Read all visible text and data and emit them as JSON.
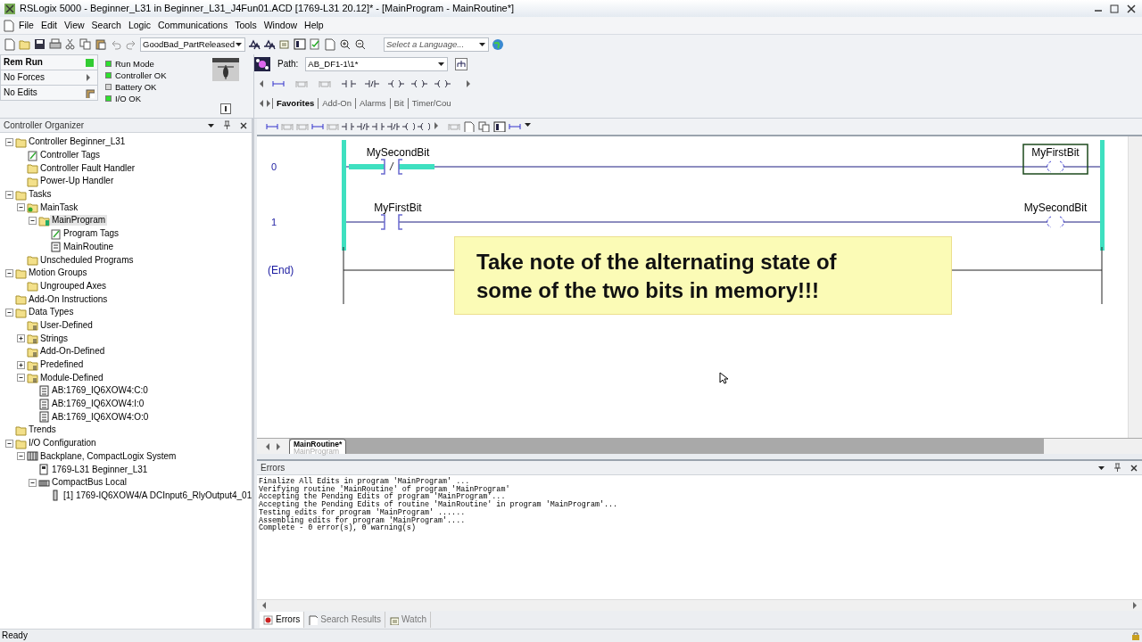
{
  "window": {
    "title": "RSLogix 5000 - Beginner_L31 in Beginner_L31_J4Fun01.ACD [1769-L31 20.12]* - [MainProgram - MainRoutine*]"
  },
  "menu": [
    "File",
    "Edit",
    "View",
    "Search",
    "Logic",
    "Communications",
    "Tools",
    "Window",
    "Help"
  ],
  "toolbar": {
    "routine_combo": "GoodBad_PartReleased",
    "language_combo": {
      "placeholder": "Select a Language..."
    }
  },
  "controller_status": {
    "rows": [
      {
        "label": "Rem Run"
      },
      {
        "label": "No Forces"
      },
      {
        "label": "No Edits"
      }
    ],
    "indicators": [
      {
        "label": "Run Mode",
        "on": true
      },
      {
        "label": "Controller OK",
        "on": true
      },
      {
        "label": "Battery OK",
        "on": false
      },
      {
        "label": "I/O OK",
        "on": true
      }
    ]
  },
  "path": {
    "label": "Path:",
    "value": "AB_DF1-1\\1*"
  },
  "instruction_tabs": [
    {
      "label": "Favorites",
      "selected": true
    },
    {
      "label": "Add-On",
      "selected": false
    },
    {
      "label": "Alarms",
      "selected": false
    },
    {
      "label": "Bit",
      "selected": false
    },
    {
      "label": "Timer/Cou",
      "selected": false
    }
  ],
  "organizer": {
    "title": "Controller Organizer",
    "tree": [
      {
        "label": "Controller Beginner_L31",
        "kind": "folder",
        "expanded": true,
        "selected": false,
        "children": [
          {
            "label": "Controller Tags",
            "kind": "tags",
            "selected": false
          },
          {
            "label": "Controller Fault Handler",
            "kind": "folder",
            "selected": false
          },
          {
            "label": "Power-Up Handler",
            "kind": "folder",
            "selected": false
          }
        ]
      },
      {
        "label": "Tasks",
        "kind": "folder",
        "expanded": true,
        "selected": false,
        "children": [
          {
            "label": "MainTask",
            "kind": "task",
            "expanded": true,
            "selected": false,
            "children": [
              {
                "label": "MainProgram",
                "kind": "program",
                "expanded": true,
                "selected": true,
                "children": [
                  {
                    "label": "Program Tags",
                    "kind": "tags",
                    "selected": false
                  },
                  {
                    "label": "MainRoutine",
                    "kind": "routine",
                    "selected": false
                  }
                ]
              }
            ]
          },
          {
            "label": "Unscheduled Programs",
            "kind": "folder",
            "selected": false
          }
        ]
      },
      {
        "label": "Motion Groups",
        "kind": "folder",
        "expanded": true,
        "selected": false,
        "children": [
          {
            "label": "Ungrouped Axes",
            "kind": "folder",
            "selected": false
          }
        ]
      },
      {
        "label": "Add-On Instructions",
        "kind": "folder",
        "selected": false
      },
      {
        "label": "Data Types",
        "kind": "folder",
        "expanded": true,
        "selected": false,
        "children": [
          {
            "label": "User-Defined",
            "kind": "datatype",
            "selected": false
          },
          {
            "label": "Strings",
            "kind": "datatype",
            "expanded": false,
            "selected": false
          },
          {
            "label": "Add-On-Defined",
            "kind": "datatype",
            "selected": false
          },
          {
            "label": "Predefined",
            "kind": "datatype",
            "expanded": false,
            "selected": false
          },
          {
            "label": "Module-Defined",
            "kind": "datatype",
            "expanded": true,
            "selected": false,
            "children": [
              {
                "label": "AB:1769_IQ6XOW4:C:0",
                "kind": "type",
                "selected": false
              },
              {
                "label": "AB:1769_IQ6XOW4:I:0",
                "kind": "type",
                "selected": false
              },
              {
                "label": "AB:1769_IQ6XOW4:O:0",
                "kind": "type",
                "selected": false
              }
            ]
          }
        ]
      },
      {
        "label": "Trends",
        "kind": "folder",
        "selected": false
      },
      {
        "label": "I/O Configuration",
        "kind": "folder",
        "expanded": true,
        "selected": false,
        "children": [
          {
            "label": "Backplane, CompactLogix System",
            "kind": "rack",
            "expanded": true,
            "selected": false,
            "children": [
              {
                "label": "1769-L31 Beginner_L31",
                "kind": "controller",
                "selected": false
              },
              {
                "label": "CompactBus Local",
                "kind": "bus",
                "expanded": true,
                "selected": false,
                "children": [
                  {
                    "label": "[1] 1769-IQ6XOW4/A DCInput6_RlyOutput4_01",
                    "kind": "card",
                    "selected": false
                  }
                ]
              }
            ]
          }
        ]
      }
    ]
  },
  "ladder": {
    "rungs": [
      {
        "number": "0",
        "energized": true,
        "contact": {
          "kind": "xio",
          "tag": "MySecondBit",
          "energized": true
        },
        "coil": {
          "tag": "MyFirstBit",
          "selected": true
        }
      },
      {
        "number": "1",
        "energized": true,
        "contact": {
          "kind": "xic",
          "tag": "MyFirstBit",
          "energized": false
        },
        "coil": {
          "tag": "MySecondBit",
          "selected": false
        }
      }
    ],
    "end_label": "(End)"
  },
  "callout": "Take note of the alternating state of some of the two bits in memory!!!",
  "routine_tab": {
    "title": "MainRoutine*",
    "subtitle": "MainProgram"
  },
  "errors_panel": {
    "title": "Errors",
    "lines": [
      "Finalize All Edits in program 'MainProgram' ...",
      "Verifying routine 'MainRoutine' of program 'MainProgram'",
      "Accepting the Pending Edits of program 'MainProgram'...",
      "Accepting the Pending Edits of routine 'MainRoutine' in program 'MainProgram'...",
      "Testing edits for program 'MainProgram' ......",
      "Assembling edits for program 'MainProgram'....",
      "Complete - 0 error(s), 0 warning(s)"
    ],
    "tabs": [
      {
        "label": "Errors",
        "selected": true
      },
      {
        "label": "Search Results",
        "selected": false
      },
      {
        "label": "Watch",
        "selected": false
      }
    ]
  },
  "status_bar": "Ready"
}
